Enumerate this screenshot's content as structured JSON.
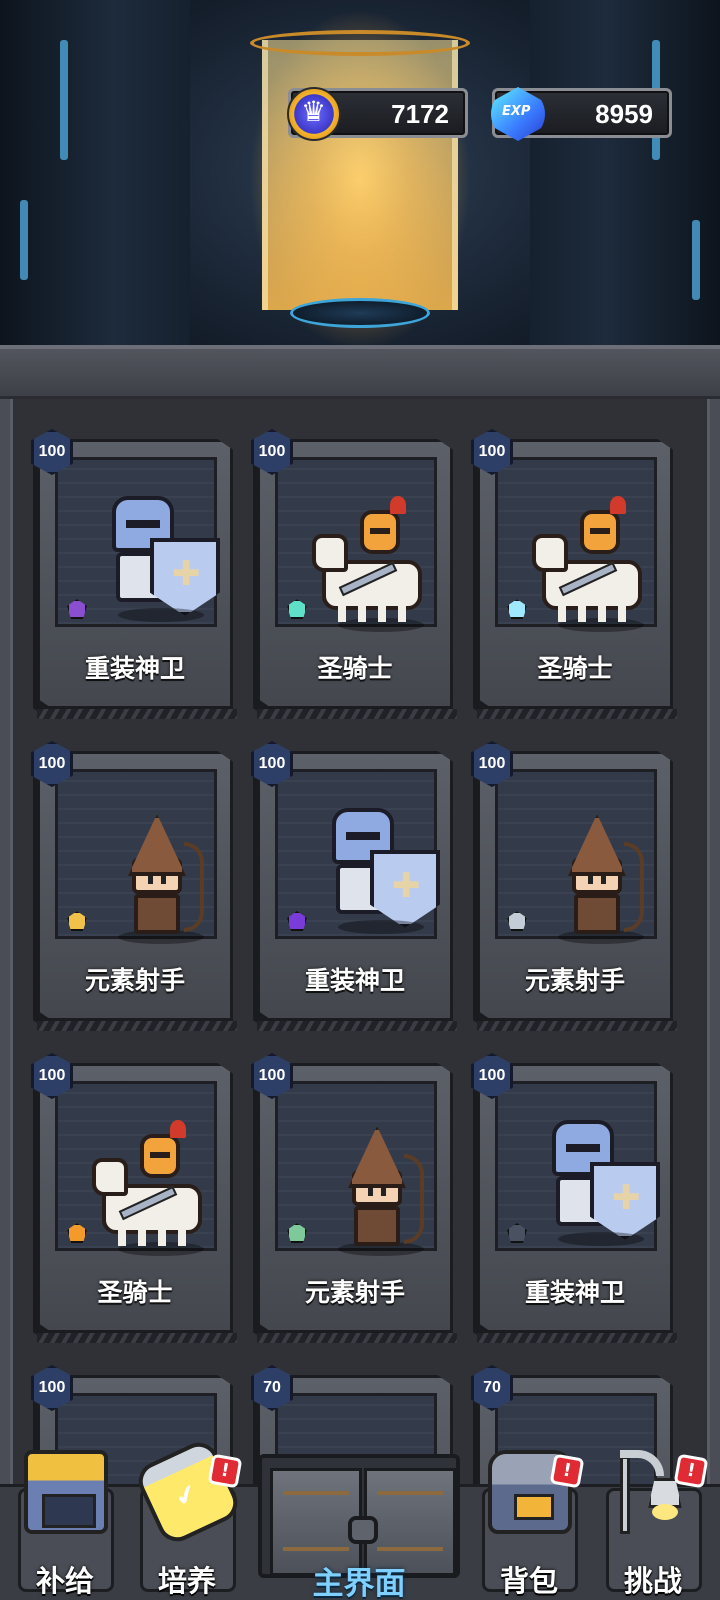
{
  "currencies": {
    "crown": {
      "icon": "crown-coin-icon",
      "value": "7172"
    },
    "exp": {
      "icon": "exp-gem-icon",
      "icon_text": "EXP",
      "value": "8959"
    }
  },
  "heroes": [
    {
      "level": "100",
      "name": "重装神卫",
      "type": "heavy-guard",
      "gem": "purple"
    },
    {
      "level": "100",
      "name": "圣骑士",
      "type": "paladin",
      "gem": "teal"
    },
    {
      "level": "100",
      "name": "圣骑士",
      "type": "paladin",
      "gem": "cyan"
    },
    {
      "level": "100",
      "name": "元素射手",
      "type": "archer",
      "gem": "gold"
    },
    {
      "level": "100",
      "name": "重装神卫",
      "type": "heavy-guard",
      "gem": "violet"
    },
    {
      "level": "100",
      "name": "元素射手",
      "type": "archer",
      "gem": "silver"
    },
    {
      "level": "100",
      "name": "圣骑士",
      "type": "paladin",
      "gem": "orange"
    },
    {
      "level": "100",
      "name": "元素射手",
      "type": "archer",
      "gem": "green"
    },
    {
      "level": "100",
      "name": "重装神卫",
      "type": "heavy-guard",
      "gem": "dark"
    },
    {
      "level": "100",
      "name": "",
      "type": "partial",
      "gem": ""
    },
    {
      "level": "70",
      "name": "",
      "type": "partial",
      "gem": ""
    },
    {
      "level": "70",
      "name": "",
      "type": "partial",
      "gem": ""
    }
  ],
  "nav": {
    "supply": {
      "label": "补给",
      "icon": "shop-icon"
    },
    "train": {
      "label": "培养",
      "icon": "potion-icon",
      "badge": "!"
    },
    "main": {
      "label": "主界面",
      "icon": "gate-icon"
    },
    "bag": {
      "label": "背包",
      "icon": "backpack-icon",
      "badge": "!"
    },
    "challenge": {
      "label": "挑战",
      "icon": "lamp-icon",
      "badge": "!"
    }
  },
  "colors": {
    "gem_purple": "#8a4fd0",
    "gem_teal": "#5fe0c8",
    "gem_cyan": "#9fe8ff",
    "gem_gold": "#f0c24a",
    "gem_violet": "#7a3cd8",
    "gem_silver": "#c4ccd8",
    "gem_orange": "#f39a2a",
    "gem_green": "#7fc89a",
    "gem_dark": "#4a5262"
  }
}
